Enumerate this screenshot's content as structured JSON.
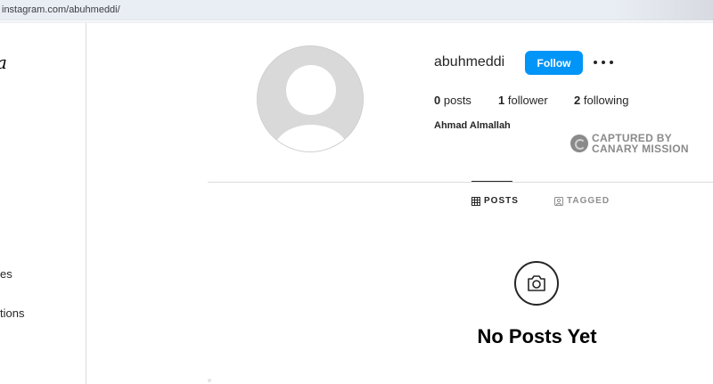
{
  "browser": {
    "url": "instagram.com/abuhmeddi/"
  },
  "sidebar": {
    "logo_fragment": "a",
    "items": [
      {
        "label": "es"
      },
      {
        "label": "tions"
      }
    ]
  },
  "profile": {
    "username": "abuhmeddi",
    "follow_label": "Follow",
    "more_icon": "more-horizontal-icon",
    "stats": {
      "posts_count": "0",
      "posts_label": "posts",
      "followers_count": "1",
      "followers_label": "follower",
      "following_count": "2",
      "following_label": "following"
    },
    "full_name": "Ahmad Almallah",
    "accent_color": "#0095f6"
  },
  "watermark": {
    "line1": "CAPTURED BY",
    "line2": "CANARY MISSION"
  },
  "tabs": [
    {
      "label": "POSTS",
      "icon": "grid-icon",
      "active": true
    },
    {
      "label": "TAGGED",
      "icon": "tagged-icon",
      "active": false
    }
  ],
  "empty_state": {
    "icon": "camera-icon",
    "title": "No Posts Yet"
  }
}
